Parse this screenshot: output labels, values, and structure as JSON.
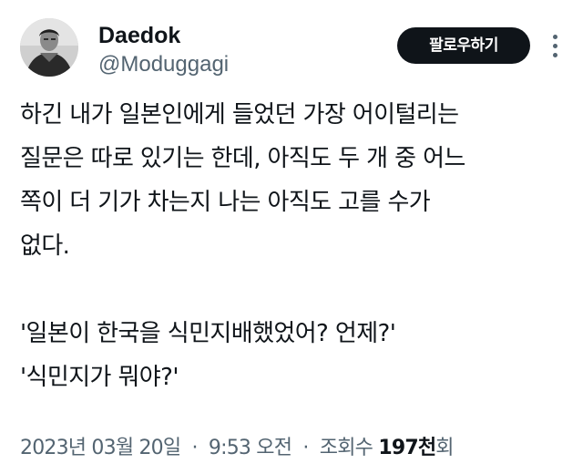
{
  "author": {
    "display_name": "Daedok",
    "handle": "@Moduggagi"
  },
  "actions": {
    "follow_label": "팔로우하기",
    "more_icon": "more-dots-icon"
  },
  "tweet": {
    "lines": [
      "하긴 내가 일본인에게 들었던 가장 어이털리는",
      "질문은 따로 있기는 한데, 아직도 두 개 중 어느",
      "쪽이 더 기가 차는지 나는 아직도 고를 수가",
      "없다.",
      "",
      "'일본이 한국을 식민지배했었어? 언제?'",
      "'식민지가 뭐야?'"
    ]
  },
  "meta": {
    "date": "2023년 03월 20일",
    "separator": "·",
    "time": "9:53 오전",
    "views_label": "조회수",
    "views_count": "197천",
    "views_suffix": "회"
  },
  "colors": {
    "text_primary": "#0f1419",
    "text_secondary": "#536471",
    "button_bg": "#0f1419",
    "button_text": "#ffffff"
  }
}
